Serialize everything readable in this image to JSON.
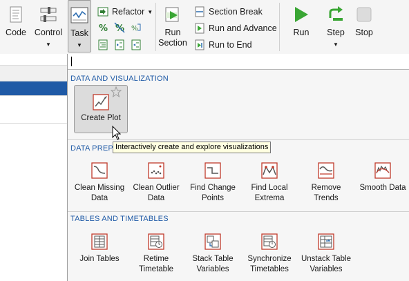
{
  "toolbar": {
    "code_label": "Code",
    "control_label": "Control",
    "task_label": "Task",
    "refactor_label": "Refactor",
    "run_section_label": "Run Section",
    "section_break_label": "Section Break",
    "run_and_advance_label": "Run and Advance",
    "run_to_end_label": "Run to End",
    "run_label": "Run",
    "step_label": "Step",
    "stop_label": "Stop",
    "dropdown_arrow": "▼"
  },
  "search": {
    "value": "",
    "placeholder": ""
  },
  "sections": {
    "data_viz": {
      "header": "DATA AND VISUALIZATION",
      "create_plot": {
        "label": "Create Plot",
        "icon": "create-plot-icon",
        "favorite_icon": "star-icon"
      }
    },
    "data_preprocessing": {
      "header_visible": "DATA PREPR",
      "items": [
        {
          "label": "Clean Missing Data",
          "icon": "clean-missing-data-icon"
        },
        {
          "label": "Clean Outlier Data",
          "icon": "clean-outlier-data-icon"
        },
        {
          "label": "Find Change Points",
          "icon": "find-change-points-icon"
        },
        {
          "label": "Find Local Extrema",
          "icon": "find-local-extrema-icon"
        },
        {
          "label": "Remove Trends",
          "icon": "remove-trends-icon"
        },
        {
          "label": "Smooth Data",
          "icon": "smooth-data-icon"
        }
      ]
    },
    "tables_timetables": {
      "header": "TABLES AND TIMETABLES",
      "items": [
        {
          "label": "Join Tables",
          "icon": "join-tables-icon"
        },
        {
          "label": "Retime Timetable",
          "icon": "retime-timetable-icon"
        },
        {
          "label": "Stack Table Variables",
          "icon": "stack-table-variables-icon"
        },
        {
          "label": "Synchronize Timetables",
          "icon": "synchronize-timetables-icon"
        },
        {
          "label": "Unstack Table Variables",
          "icon": "unstack-table-variables-icon"
        }
      ]
    }
  },
  "tooltip": {
    "text": "Interactively create and explore visualizations"
  },
  "colors": {
    "accent": "#1f5aa6",
    "run_green": "#3aa634",
    "tooltip_bg": "#ffffe1",
    "icon_red": "#c03a2b"
  }
}
